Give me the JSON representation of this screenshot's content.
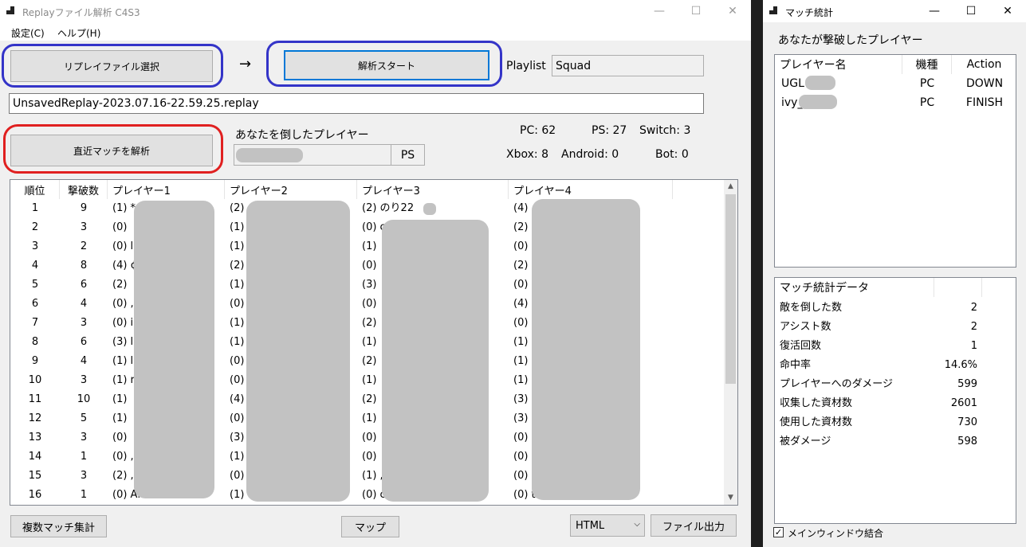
{
  "main_window": {
    "title": "Replayファイル解析 C4S3",
    "controls": {
      "minimize": "—",
      "maximize": "☐",
      "close": "✕"
    },
    "menu": [
      "設定(C)",
      "ヘルプ(H)"
    ],
    "select_replay_button": "リプレイファイル選択",
    "arrow": "→",
    "start_button": "解析スタート",
    "playlist_label": "Playlist",
    "playlist_value": "Squad",
    "replay_path": "UnsavedReplay-2023.07.16-22.59.25.replay",
    "analyze_recent_button": "直近マッチを解析",
    "killer_label": "あなたを倒したプレイヤー",
    "killer_platform": "PS",
    "platform_counts": {
      "pc": "PC: 62",
      "ps": "PS: 27",
      "switch": "Switch: 3",
      "xbox": "Xbox: 8",
      "android": "Android: 0",
      "bot": "Bot: 0"
    },
    "table": {
      "columns": [
        "順位",
        "撃破数",
        "プレイヤー1",
        "プレイヤー2",
        "プレイヤー3",
        "プレイヤー4"
      ],
      "rows": [
        [
          "1",
          "9",
          "(1) *",
          "(2)",
          "(2) のり22",
          "(4)"
        ],
        [
          "2",
          "3",
          "(0)",
          "(1)",
          "(0) c",
          "(2)"
        ],
        [
          "3",
          "2",
          "(0) l",
          "(1)",
          "(1)",
          "(0)"
        ],
        [
          "4",
          "8",
          "(4) ¢",
          "(2)",
          "(0)",
          "(2)"
        ],
        [
          "5",
          "6",
          "(2)",
          "(1)",
          "(3)",
          "(0)"
        ],
        [
          "6",
          "4",
          "(0) ,",
          "(0)",
          "(0)",
          "(4)"
        ],
        [
          "7",
          "3",
          "(0) i",
          "(1)",
          "(2)",
          "(0)"
        ],
        [
          "8",
          "6",
          "(3) l",
          "(1)",
          "(1)",
          "(1)"
        ],
        [
          "9",
          "4",
          "(1) l",
          "(0)",
          "(2)",
          "(1)"
        ],
        [
          "10",
          "3",
          "(1) r",
          "(0)",
          "(1)",
          "(1)"
        ],
        [
          "11",
          "10",
          "(1)",
          "(4)",
          "(2)",
          "(3)"
        ],
        [
          "12",
          "5",
          "(1)",
          "(0)",
          "(1)",
          "(3)"
        ],
        [
          "13",
          "3",
          "(0)",
          "(3)",
          "(0)",
          "(0)"
        ],
        [
          "14",
          "1",
          "(0) ,",
          "(1)",
          "(0)",
          "(0)"
        ],
        [
          "15",
          "3",
          "(2) ,",
          "(0)",
          "(1) ,",
          "(0)"
        ],
        [
          "16",
          "1",
          "(0) Ar",
          "(1)",
          "(0) c",
          "(0) t"
        ]
      ]
    },
    "multi_match_button": "複数マッチ集計",
    "map_button": "マップ",
    "format_select": "HTML",
    "file_output_button": "ファイル出力"
  },
  "side_window": {
    "title": "マッチ統計",
    "controls": {
      "minimize": "—",
      "maximize": "☐",
      "close": "✕"
    },
    "defeated_label": "あなたが撃破したプレイヤー",
    "defeated_table": {
      "columns": [
        "プレイヤー名",
        "機種",
        "Action"
      ],
      "rows": [
        [
          "UGL",
          "PC",
          "DOWN"
        ],
        [
          "ivy_",
          "PC",
          "FINISH"
        ]
      ]
    },
    "stats_table": {
      "header": "マッチ統計データ",
      "rows": [
        [
          "敵を倒した数",
          "2"
        ],
        [
          "アシスト数",
          "2"
        ],
        [
          "復活回数",
          "1"
        ],
        [
          "命中率",
          "14.6%"
        ],
        [
          "プレイヤーへのダメージ",
          "599"
        ],
        [
          "収集した資材数",
          "2601"
        ],
        [
          "使用した資材数",
          "730"
        ],
        [
          "被ダメージ",
          "598"
        ]
      ]
    },
    "merge_checkbox_label": "メインウィンドウ結合",
    "merge_checked": "✓"
  }
}
